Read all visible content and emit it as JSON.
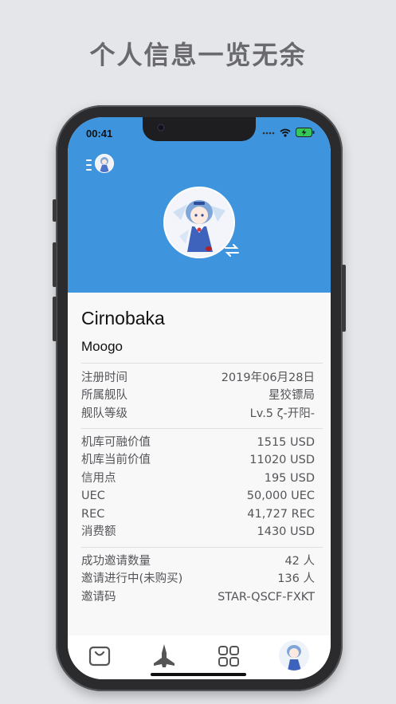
{
  "headline": "个人信息一览无余",
  "status_bar": {
    "time": "00:41"
  },
  "profile": {
    "username": "Cirnobaka",
    "fleet": "Moogo"
  },
  "sections": [
    {
      "rows": [
        {
          "label": "注册时间",
          "value": "2019年06月28日"
        },
        {
          "label": "所属舰队",
          "value": "星狡镖局"
        },
        {
          "label": "舰队等级",
          "value": "Lv.5 ζ-开阳-"
        }
      ]
    },
    {
      "rows": [
        {
          "label": "机库可融价值",
          "value": "1515 USD"
        },
        {
          "label": "机库当前价值",
          "value": "11020 USD"
        },
        {
          "label": "信用点",
          "value": "195 USD"
        },
        {
          "label": "UEC",
          "value": "50,000 UEC"
        },
        {
          "label": "REC",
          "value": "41,727 REC"
        },
        {
          "label": "消费额",
          "value": "1430 USD"
        }
      ]
    },
    {
      "rows": [
        {
          "label": "成功邀请数量",
          "value": "42 人"
        },
        {
          "label": "邀请进行中(未购买)",
          "value": "136 人"
        },
        {
          "label": "邀请码",
          "value": "STAR-QSCF-FXKT"
        }
      ]
    }
  ],
  "tabs": [
    {
      "icon": "shop-bag-icon"
    },
    {
      "icon": "spaceship-icon"
    },
    {
      "icon": "grid-icon"
    },
    {
      "icon": "profile-avatar-icon"
    }
  ],
  "colors": {
    "hero": "#3e95dd",
    "background": "#e4e6ea",
    "text": "#555559"
  }
}
